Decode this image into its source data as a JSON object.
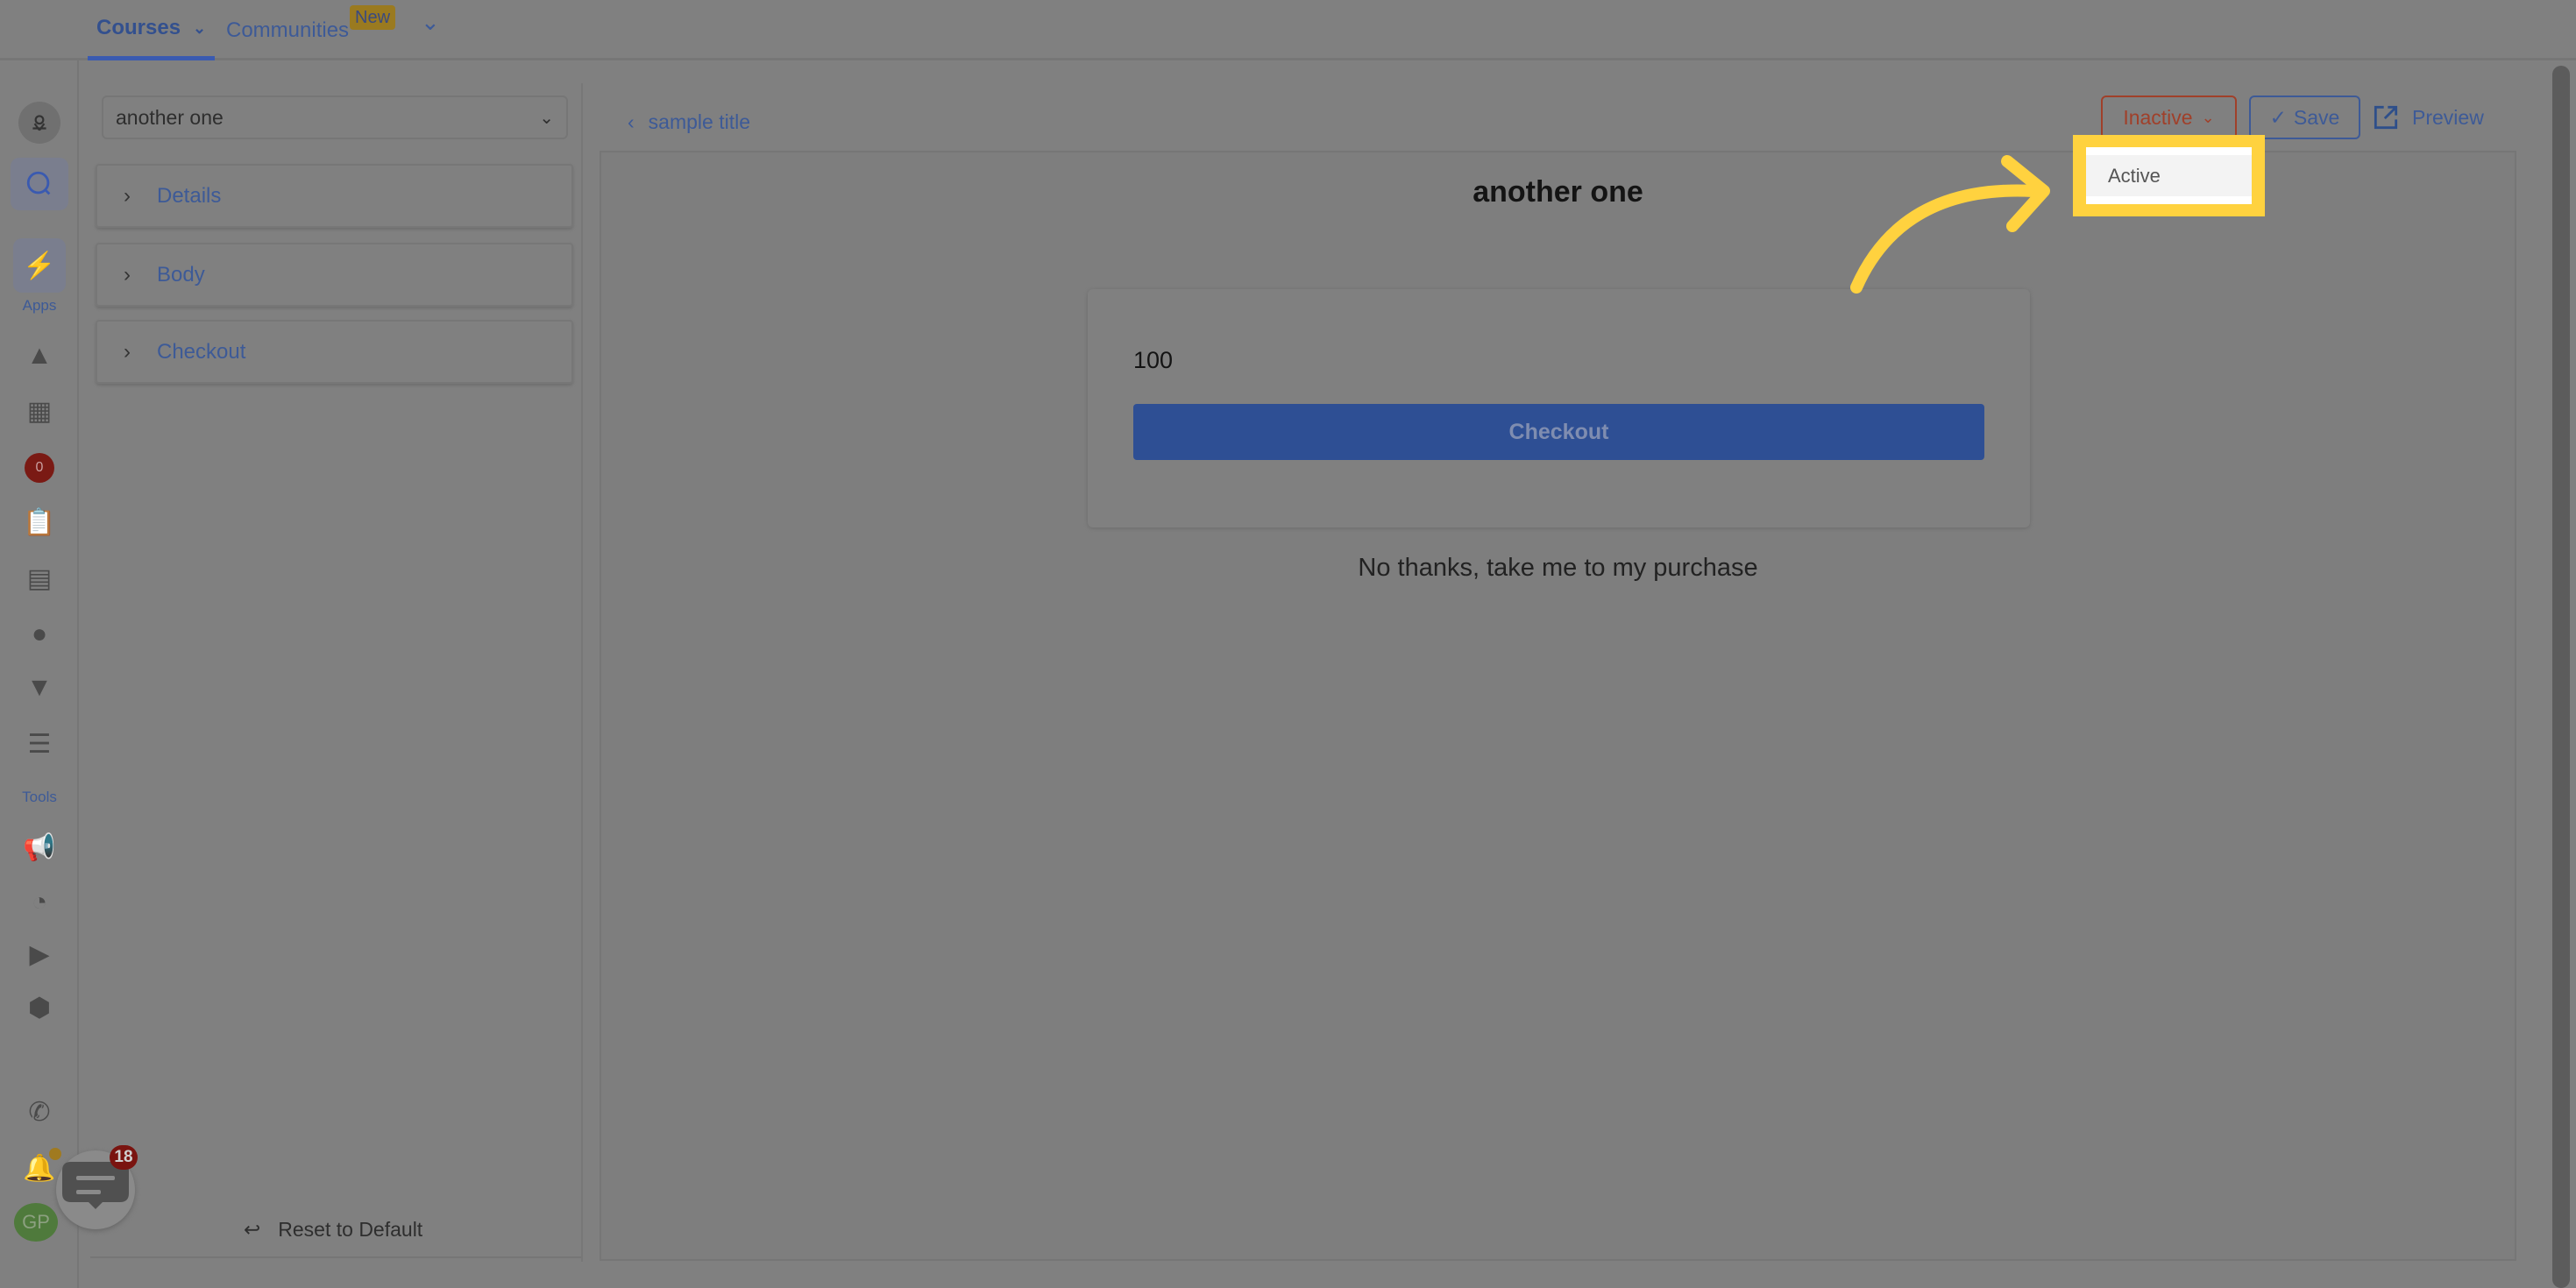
{
  "topnav": {
    "tabs": [
      {
        "label": "Courses",
        "active": true
      },
      {
        "label": "Communities",
        "badge": "New"
      }
    ]
  },
  "rail": {
    "apps_label": "Apps",
    "tools_label": "Tools",
    "notification_count": "0",
    "avatar_initials": "GP",
    "chat_badge": "18",
    "icons": [
      "location-icon",
      "search-icon",
      "lightning-icon",
      "triangle-logo-icon",
      "grid-icon",
      "notification-badge",
      "clipboard-icon",
      "calendar-icon",
      "user-icon",
      "filter-icon",
      "list-icon",
      "megaphone-icon",
      "pie-chart-icon",
      "video-icon",
      "settings-hex-icon",
      "phone-icon",
      "bell-icon"
    ]
  },
  "panel": {
    "select_value": "another one",
    "sections": [
      "Details",
      "Body",
      "Checkout"
    ],
    "reset_label": "Reset to Default"
  },
  "header": {
    "back_label": "sample title",
    "status_label": "Inactive",
    "save_label": "Save",
    "preview_label": "Preview"
  },
  "status_dropdown": {
    "options": [
      "Active"
    ]
  },
  "preview": {
    "title": "another one",
    "amount": "100",
    "checkout_label": "Checkout",
    "decline_label": "No thanks, take me to my purchase"
  },
  "colors": {
    "accent": "#3a5ab0",
    "highlight": "#ffd23f",
    "inactive": "#a0402a"
  }
}
